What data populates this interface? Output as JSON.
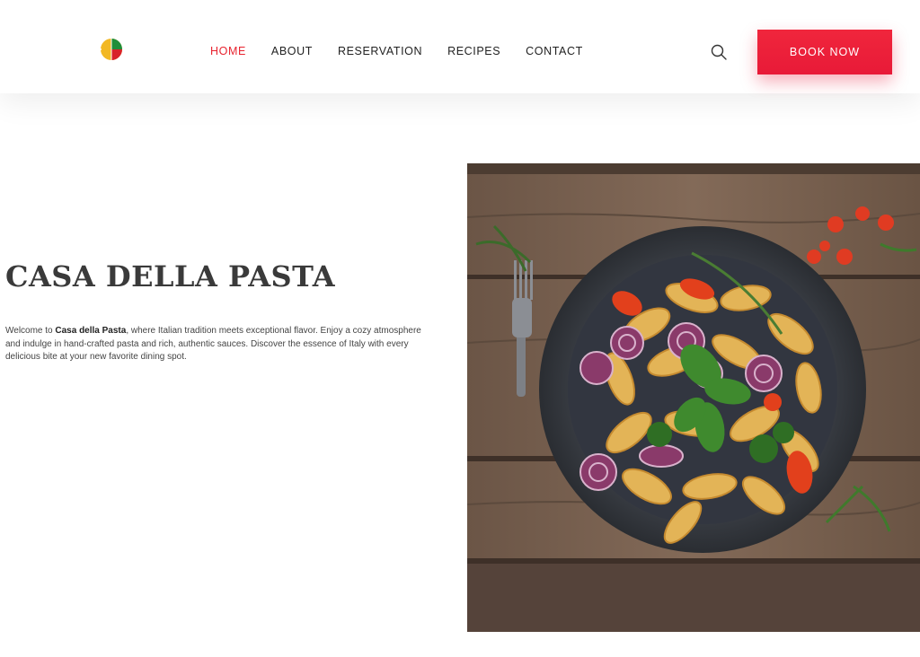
{
  "header": {
    "logo_icon": "pie-chart-logo",
    "nav": [
      {
        "label": "HOME",
        "active": true
      },
      {
        "label": "ABOUT",
        "active": false
      },
      {
        "label": "RESERVATION",
        "active": false
      },
      {
        "label": "RECIPES",
        "active": false
      },
      {
        "label": "CONTACT",
        "active": false
      }
    ],
    "search_icon": "search-icon",
    "cta_label": "BOOK NOW"
  },
  "hero": {
    "title": "CASA DELLA PASTA",
    "intro_prefix": "Welcome to ",
    "intro_brand": "Casa della Pasta",
    "intro_suffix": ", where Italian tradition meets exceptional flavor. Enjoy a cozy atmosphere and indulge in hand-crafted pasta and rich, authentic sauces. Discover the essence of Italy with every delicious bite at your new favorite dining spot."
  },
  "colors": {
    "accent": "#e8232f",
    "button": "#ed1f3a",
    "title": "#3a3a3a",
    "logo_yellow": "#f2b824",
    "logo_green": "#1f8e3a",
    "logo_red": "#d8232a"
  }
}
